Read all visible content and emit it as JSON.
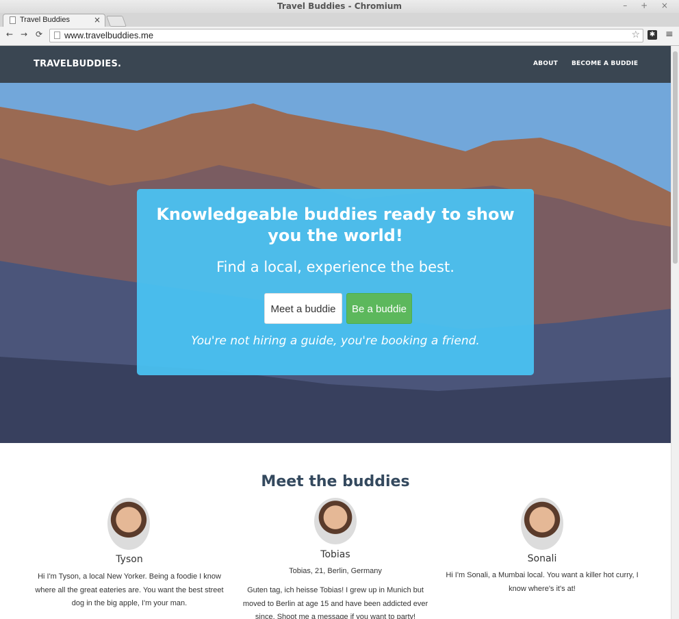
{
  "window": {
    "title": "Travel Buddies - Chromium",
    "controls": "– + ×"
  },
  "tabs": [
    {
      "label": "Travel Buddies",
      "close": "×"
    }
  ],
  "toolbar": {
    "url": "www.travelbuddies.me",
    "back": "←",
    "forward": "→",
    "reload": "⟳",
    "star": "☆",
    "ext": "✱",
    "menu": "≡"
  },
  "site_nav": {
    "brand": "TRAVELBUDDIES.",
    "links": [
      "ABOUT",
      "BECOME A BUDDIE"
    ]
  },
  "hero": {
    "title": "Knowledgeable buddies ready to show you the world!",
    "subtitle": "Find a local, experience the best.",
    "buttons": [
      "Meet a buddie",
      "Be a buddie"
    ],
    "tagline": "You're not hiring a guide, you're booking a friend."
  },
  "buddies_section": {
    "title": "Meet the buddies",
    "buddies": [
      {
        "name": "Tyson",
        "meta": "",
        "bio": "Hi I'm Tyson, a local New Yorker. Being a foodie I know where all the great eateries are. You want the best street dog in the big apple, I'm your man."
      },
      {
        "name": "Tobias",
        "meta": "Tobias, 21, Berlin, Germany",
        "bio": "Guten tag, ich heisse Tobias! I grew up in Munich but moved to Berlin at age 15 and have been addicted ever since. Shoot me a message if you want to party!"
      },
      {
        "name": "Sonali",
        "meta": "",
        "bio": "Hi I'm Sonali, a Mumbai local. You want a killer hot curry, I know where's it's at!"
      }
    ]
  }
}
